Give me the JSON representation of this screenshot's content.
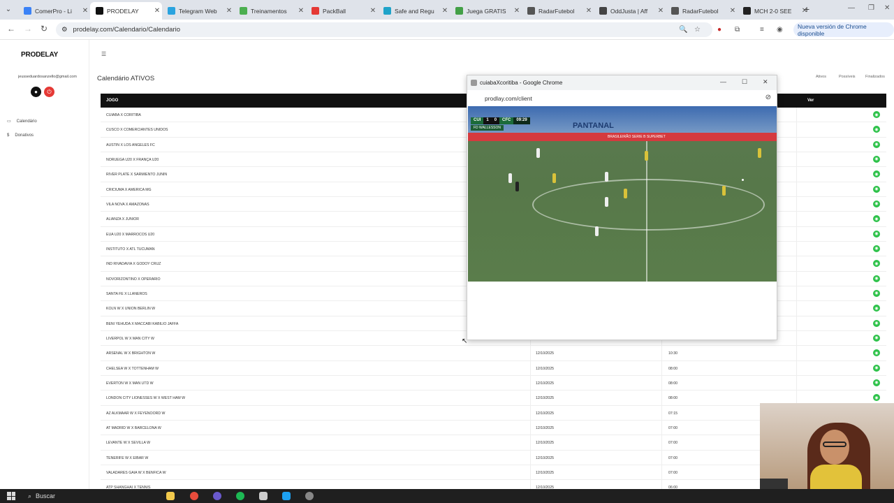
{
  "browser": {
    "tabs": [
      {
        "title": "ComerPro - Li",
        "color": "#3b82f6"
      },
      {
        "title": "PRODELAY",
        "color": "#111111",
        "active": true
      },
      {
        "title": "Telegram Web",
        "color": "#2aa3df"
      },
      {
        "title": "Treinamentos",
        "color": "#4caf50"
      },
      {
        "title": "PackBall",
        "color": "#e53935"
      },
      {
        "title": "Safe and Regu",
        "color": "#1fa3c9"
      },
      {
        "title": "Juega GRATIS",
        "color": "#43a047"
      },
      {
        "title": "RadarFutebol",
        "color": "#555555"
      },
      {
        "title": "OddJusta | Aff",
        "color": "#444444"
      },
      {
        "title": "RadarFutebol",
        "color": "#555555"
      },
      {
        "title": "MCH 2-0 SEE",
        "color": "#222222"
      }
    ],
    "url": "prodelay.com/Calendario/Calendario",
    "update_notice": "Nueva versión de Chrome disponible"
  },
  "sidebar": {
    "logo": "PRODELAY",
    "email": "jeusseduardosanzello@gmail.com",
    "items": [
      {
        "label": "Calendário",
        "icon": "calendar-icon"
      },
      {
        "label": "Donativos",
        "icon": "dollar-icon"
      }
    ]
  },
  "main": {
    "title": "Calendário ATIVOS",
    "filters": [
      "Ativos",
      "Possíveis",
      "Finalizados"
    ],
    "columns": {
      "game": "JOGO",
      "view": "Ver"
    },
    "rows": [
      {
        "game": "CUIABA X CORITIBA",
        "date": "",
        "time": ""
      },
      {
        "game": "CUSCO X COMERCIANTES UNIDOS",
        "date": "",
        "time": ""
      },
      {
        "game": "AUSTIN X LOS ANGELES FC",
        "date": "",
        "time": ""
      },
      {
        "game": "NORUEGA U20 X FRANÇA U20",
        "date": "",
        "time": ""
      },
      {
        "game": "RIVER PLATE X SARMIENTO JUNIN",
        "date": "",
        "time": ""
      },
      {
        "game": "CRICIUMA X AMERICA MG",
        "date": "",
        "time": ""
      },
      {
        "game": "VILA NOVA X AMAZONAS",
        "date": "",
        "time": ""
      },
      {
        "game": "ALIANZA X JUNIOR",
        "date": "",
        "time": ""
      },
      {
        "game": "EUA U20 X MARROCOS U20",
        "date": "",
        "time": ""
      },
      {
        "game": "INSTITUTO X ATL TUCUMAN",
        "date": "",
        "time": ""
      },
      {
        "game": "IND RIVADAVIA X GODOY CRUZ",
        "date": "",
        "time": ""
      },
      {
        "game": "NOVORIZONTINO X OPERARIO",
        "date": "",
        "time": ""
      },
      {
        "game": "SANTA FE X LLANEROS",
        "date": "",
        "time": ""
      },
      {
        "game": "KOLN W X UNION BERLIN W",
        "date": "",
        "time": ""
      },
      {
        "game": "BENI YEHUDA X MACCABI KABILIO JAFFA",
        "date": "",
        "time": ""
      },
      {
        "game": "LIVERPOL W X MAN CITY W",
        "date": "",
        "time": ""
      },
      {
        "game": "ARSENAL W X BRIGHTON W",
        "date": "12/10/2025",
        "time": "10:30"
      },
      {
        "game": "CHELSEA W X TOTTENHAM W",
        "date": "12/10/2025",
        "time": "08:00"
      },
      {
        "game": "EVERTON W X MAN UTD W",
        "date": "12/10/2025",
        "time": "08:00"
      },
      {
        "game": "LONDON CITY LIONESSES W X WEST HAM W",
        "date": "12/10/2025",
        "time": "08:00"
      },
      {
        "game": "AZ ALKMAAR W X FEYENOORD W",
        "date": "12/10/2025",
        "time": "07:15"
      },
      {
        "game": "AT MADRID W X BARCELONA W",
        "date": "12/10/2025",
        "time": "07:00"
      },
      {
        "game": "LEVANTE W X SEVILLA W",
        "date": "12/10/2025",
        "time": "07:00"
      },
      {
        "game": "TENERIFE W X EIBAR W",
        "date": "12/10/2025",
        "time": "07:00"
      },
      {
        "game": "VALADARES GAIA W X BENFICA W",
        "date": "12/10/2025",
        "time": "07:00"
      },
      {
        "game": "ATP SHANGHAI X TENNIS",
        "date": "12/10/2025",
        "time": "06:00"
      }
    ]
  },
  "popup": {
    "title": "cuiabaXcoritiba - Google Chrome",
    "url": "prodlay.com/client",
    "scoreboard": {
      "home": "CUI",
      "home_score": "1",
      "away_score": "0",
      "away": "CFC",
      "clock": "09:29"
    },
    "scorer": "FD WALLESSON",
    "stadium_text": "PANTANAL",
    "ad_text": "BRASILEIRÃO SERIE B SUPERBET"
  },
  "taskbar": {
    "search_placeholder": "Buscar"
  }
}
